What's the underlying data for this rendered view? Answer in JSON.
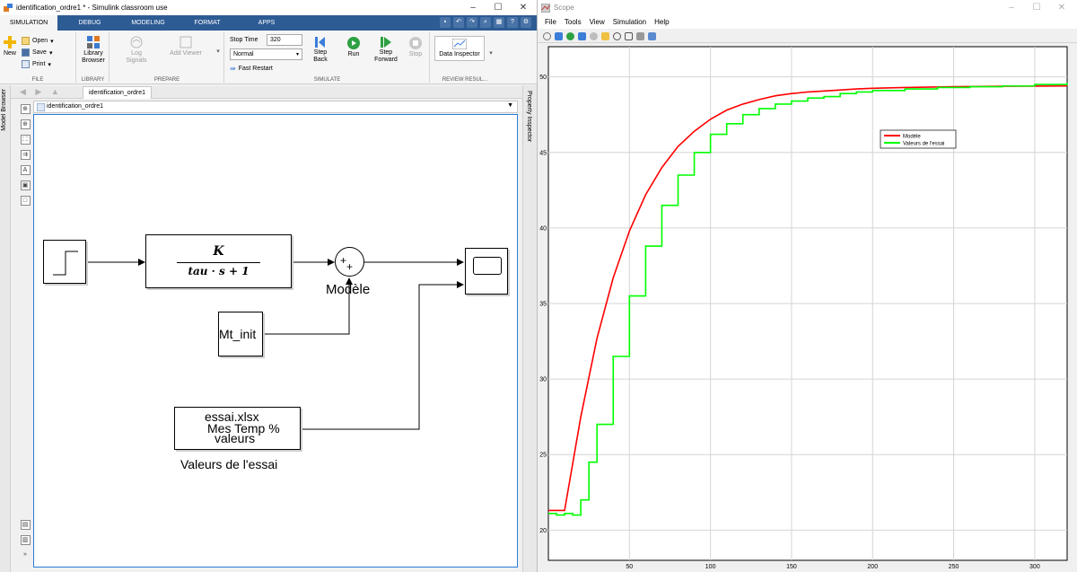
{
  "simulink": {
    "window_title": "identification_ordre1 * - Simulink classroom use",
    "tabs": [
      "SIMULATION",
      "DEBUG",
      "MODELING",
      "FORMAT",
      "APPS"
    ],
    "ribbon": {
      "file": {
        "new": "New",
        "open": "Open",
        "save": "Save",
        "print": "Print",
        "group": "FILE"
      },
      "library": {
        "browser": "Library Browser",
        "group": "LIBRARY"
      },
      "prepare": {
        "log_signals": "Log Signals",
        "add_viewer": "Add Viewer",
        "group": "PREPARE"
      },
      "simulate": {
        "stop_time_label": "Stop Time",
        "stop_time_value": "320",
        "mode": "Normal",
        "fast_restart": "Fast Restart",
        "step_back": "Step Back",
        "run": "Run",
        "step_forward": "Step Forward",
        "stop": "Stop",
        "group": "SIMULATE"
      },
      "review": {
        "data_inspector": "Data Inspector",
        "group": "REVIEW RESUL..."
      }
    },
    "left_rail_label": "Model Browser",
    "right_rail_label": "Property Inspector",
    "breadcrumb": "identification_ordre1",
    "address": "identification_ordre1",
    "diagram": {
      "transfer_numerator": "K",
      "transfer_denominator": "tau · s + 1",
      "sum_label": "Modèle",
      "constant": "Mt_init",
      "from_file_line1": "essai.xlsx",
      "from_file_line2": "Mes Temp %",
      "from_file_line3": "valeurs",
      "from_file_label": "Valeurs de l'essai"
    }
  },
  "scope": {
    "window_title": "Scope",
    "menu": [
      "File",
      "Tools",
      "View",
      "Simulation",
      "Help"
    ],
    "chart_data": {
      "type": "line",
      "title": "",
      "xlabel": "",
      "ylabel": "",
      "xlim": [
        0,
        320
      ],
      "ylim": [
        18,
        52
      ],
      "x_ticks": [
        50,
        100,
        150,
        200,
        250,
        300
      ],
      "y_ticks": [
        20,
        25,
        30,
        35,
        40,
        45,
        50
      ],
      "grid": true,
      "legend_position": "top-right",
      "series": [
        {
          "name": "Modèle",
          "color": "#ff0000",
          "x": [
            0,
            10,
            20,
            30,
            40,
            50,
            60,
            70,
            80,
            90,
            100,
            110,
            120,
            130,
            140,
            150,
            160,
            175,
            190,
            200,
            220,
            250,
            280,
            300,
            320
          ],
          "y": [
            21.3,
            21.3,
            27.5,
            32.7,
            36.7,
            39.8,
            42.2,
            44.0,
            45.4,
            46.4,
            47.2,
            47.8,
            48.2,
            48.5,
            48.75,
            48.9,
            49.0,
            49.1,
            49.2,
            49.25,
            49.3,
            49.35,
            49.38,
            49.39,
            49.4
          ]
        },
        {
          "name": "Valeurs de l'essai",
          "color": "#00ff00",
          "x": [
            0,
            5,
            10,
            15,
            20,
            25,
            30,
            40,
            50,
            60,
            70,
            80,
            90,
            100,
            110,
            120,
            130,
            140,
            150,
            160,
            170,
            180,
            190,
            200,
            220,
            240,
            260,
            280,
            300,
            320
          ],
          "y": [
            21.1,
            21.0,
            21.1,
            21.0,
            22.0,
            24.5,
            27.0,
            31.5,
            35.5,
            38.8,
            41.5,
            43.5,
            45.0,
            46.2,
            46.9,
            47.5,
            47.9,
            48.2,
            48.4,
            48.6,
            48.7,
            48.9,
            49.0,
            49.1,
            49.2,
            49.3,
            49.35,
            49.4,
            49.5,
            49.6
          ]
        }
      ]
    }
  }
}
